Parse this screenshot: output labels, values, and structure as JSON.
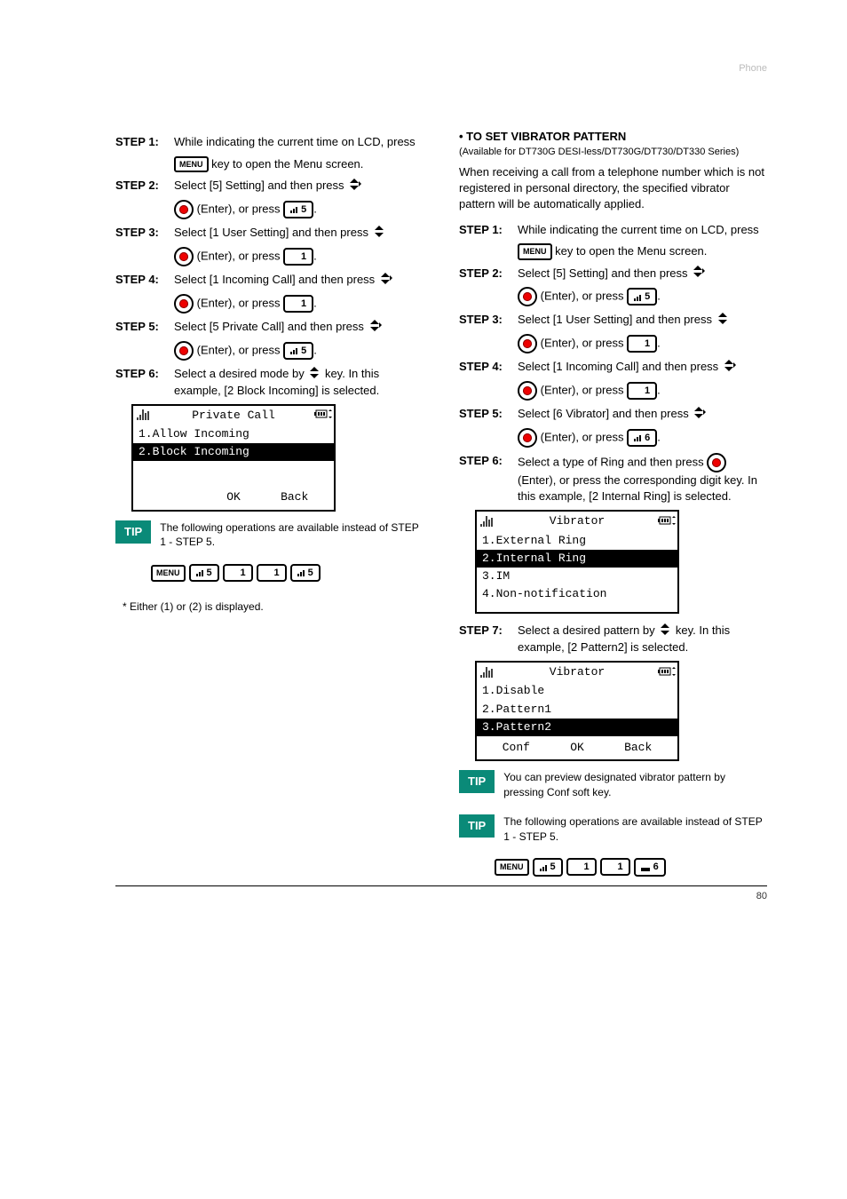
{
  "header": {
    "left": "",
    "right": "Phone"
  },
  "labels": {
    "menu_key": "MENU",
    "tip": "TIP"
  },
  "left_col": {
    "step1": {
      "label": "STEP 1:",
      "text_a": "While indicating the current time on LCD, press",
      "text_b": "key to open the Menu screen."
    },
    "step2": {
      "label": "STEP 2:",
      "text_a": "Select [5] Setting] and then press",
      "text_b": "(Enter), or press"
    },
    "step3": {
      "label": "STEP 3:",
      "text_a": "Select [1 User Setting] and then press",
      "text_b": "(Enter), or press"
    },
    "step4": {
      "label": "STEP 4:",
      "text_a": "Select [1 Incoming Call] and then press",
      "text_b": "(Enter), or press"
    },
    "step5": {
      "label": "STEP 5:",
      "text_a": "Select [5 Private Call] and then press",
      "text_b": "(Enter), or press"
    },
    "step6": {
      "label": "STEP 6:",
      "text_a": "Select a desired mode by",
      "text_b": "key. In this example, [2 Block Incoming] is selected."
    },
    "screen1": {
      "title": "Private Call",
      "items": [
        "1.Allow Incoming",
        "2.Block Incoming"
      ],
      "selected": 1,
      "sk_left": "",
      "sk_mid": "OK",
      "sk_right": "Back"
    },
    "tip_text": "The following operations are available instead of STEP 1 - STEP 5.",
    "shortcut": [
      "MENU",
      "5",
      "1",
      "1",
      "5"
    ],
    "shortcut_keys_style": [
      "menu",
      "bars5",
      "plain1",
      "plain1",
      "bars5"
    ],
    "bottom_note": "* Either (1) or (2) is displayed."
  },
  "right_col": {
    "heading": "• TO SET VIBRATOR PATTERN",
    "intro": "(Available for DT730G DESI-less/DT730G/DT730/DT330 Series)",
    "desc": "When receiving a call from a telephone number which is not registered in personal directory, the specified vibrator pattern will be automatically applied.",
    "step1": {
      "label": "STEP 1:",
      "text_a": "While indicating the current time on LCD, press",
      "text_b": "key to open the Menu screen."
    },
    "step2": {
      "label": "STEP 2:",
      "text_a": "Select [5] Setting] and then press",
      "text_b": "(Enter), or press"
    },
    "step3": {
      "label": "STEP 3:",
      "text_a": "Select [1 User Setting] and then press",
      "text_b": "(Enter), or press"
    },
    "step4": {
      "label": "STEP 4:",
      "text_a": "Select [1 Incoming Call] and then press",
      "text_b": "(Enter), or press"
    },
    "step5": {
      "label": "STEP 5:",
      "text_a": "Select [6 Vibrator] and then press",
      "text_b": "(Enter), or press"
    },
    "step6": {
      "label": "STEP 6:",
      "text_a": "Select a type of Ring and then press",
      "text_b": "(Enter), or press the corresponding digit key. In this example, [2 Internal Ring] is selected."
    },
    "screen1": {
      "title": "Vibrator",
      "items": [
        "1.External Ring",
        "2.Internal Ring",
        "3.IM",
        "4.Non-notification"
      ],
      "selected": 1
    },
    "step7": {
      "label": "STEP 7:",
      "text_a": "Select a desired pattern by",
      "text_b": "key. In this example, [2 Pattern2] is selected."
    },
    "screen2": {
      "title": "Vibrator",
      "items": [
        "1.Disable",
        "2.Pattern1",
        "3.Pattern2"
      ],
      "selected": 2,
      "sk_left": "Conf",
      "sk_mid": "OK",
      "sk_right": "Back"
    },
    "tip1_text": "You can preview designated vibrator pattern by pressing Conf soft key.",
    "tip2_text": "The following operations are available instead of STEP 1 - STEP 5.",
    "shortcut": [
      "MENU",
      "5",
      "1",
      "1",
      "6"
    ],
    "shortcut_keys_style": [
      "menu",
      "bars5",
      "plain1",
      "plain1",
      "bars6"
    ]
  },
  "footer": {
    "left": "",
    "right": "80"
  }
}
